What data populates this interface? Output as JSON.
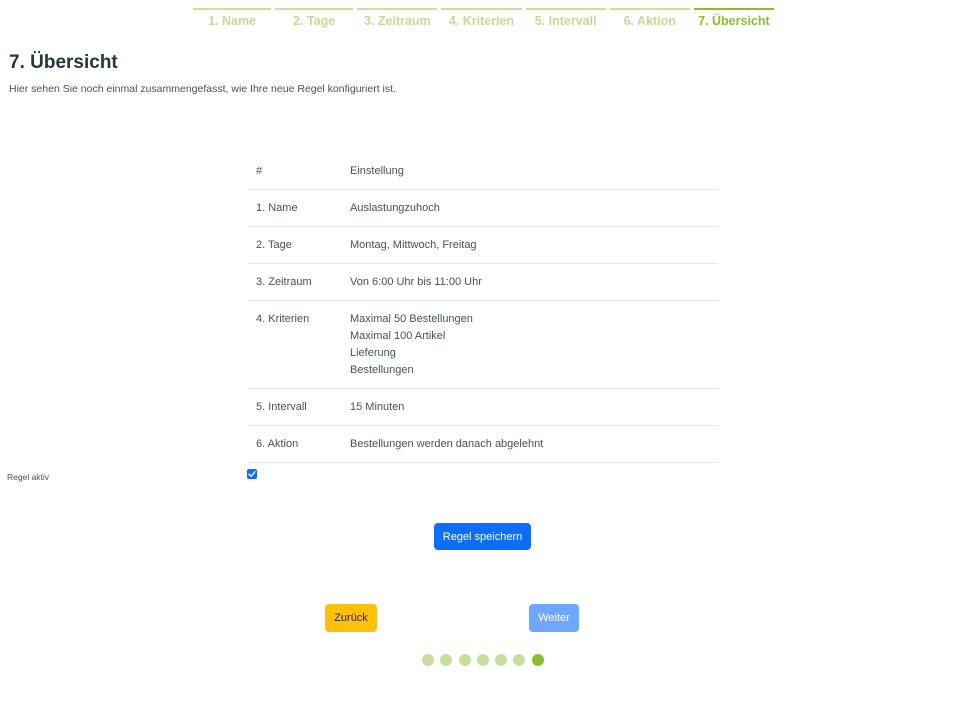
{
  "steps": [
    {
      "label": "1. Name",
      "active": false
    },
    {
      "label": "2. Tage",
      "active": false
    },
    {
      "label": "3. Zeitraum",
      "active": false
    },
    {
      "label": "4. Kriterien",
      "active": false
    },
    {
      "label": "5. Intervall",
      "active": false
    },
    {
      "label": "6. Aktion",
      "active": false
    },
    {
      "label": "7. Übersicht",
      "active": true
    }
  ],
  "page": {
    "title": "7. Übersicht",
    "subtitle": "Hier sehen Sie noch einmal zusammengefasst, wie Ihre neue Regel konfiguriert ist."
  },
  "table": {
    "headers": [
      "#",
      "Einstellung"
    ],
    "rows": [
      {
        "key": "1. Name",
        "values": [
          "Auslastungzuhoch"
        ]
      },
      {
        "key": "2. Tage",
        "values": [
          "Montag, Mittwoch, Freitag"
        ]
      },
      {
        "key": "3. Zeitraum",
        "values": [
          "Von 6:00 Uhr bis 11:00 Uhr"
        ]
      },
      {
        "key": "4. Kriterien",
        "values": [
          "Maximal 50 Bestellungen",
          "Maximal 100 Artikel",
          "Lieferung",
          "Bestellungen"
        ]
      },
      {
        "key": "5. Intervall",
        "values": [
          "15 Minuten"
        ]
      },
      {
        "key": "6. Aktion",
        "values": [
          "Bestellungen werden danach abgelehnt"
        ]
      }
    ]
  },
  "rule_active": {
    "label": "Regel aktiv",
    "checked": true
  },
  "buttons": {
    "save": "Regel speichern",
    "back": "Zurück",
    "next": "Weiter"
  },
  "pagination": {
    "total": 7,
    "current": 7
  },
  "colors": {
    "accent_green": "#8dbd2e",
    "light_green": "#c7df9c",
    "primary_blue": "#0d6efd",
    "light_blue": "#6ea8fe",
    "warning_yellow": "#ffc107"
  }
}
